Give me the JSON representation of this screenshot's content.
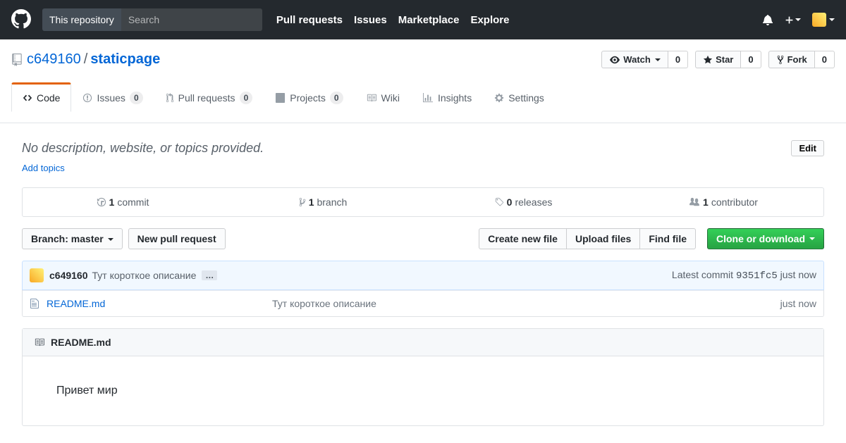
{
  "header": {
    "scope_label": "This repository",
    "search_placeholder": "Search",
    "nav": {
      "pulls": "Pull requests",
      "issues": "Issues",
      "marketplace": "Marketplace",
      "explore": "Explore"
    }
  },
  "repo": {
    "owner": "c649160",
    "separator": "/",
    "name": "staticpage"
  },
  "actions": {
    "watch": {
      "label": "Watch",
      "count": "0"
    },
    "star": {
      "label": "Star",
      "count": "0"
    },
    "fork": {
      "label": "Fork",
      "count": "0"
    }
  },
  "tabs": {
    "code": "Code",
    "issues": {
      "label": "Issues",
      "count": "0"
    },
    "pulls": {
      "label": "Pull requests",
      "count": "0"
    },
    "projects": {
      "label": "Projects",
      "count": "0"
    },
    "wiki": "Wiki",
    "insights": "Insights",
    "settings": "Settings"
  },
  "meta": {
    "description": "No description, website, or topics provided.",
    "edit": "Edit",
    "add_topics": "Add topics"
  },
  "summary": {
    "commits": {
      "num": "1",
      "label": "commit"
    },
    "branches": {
      "num": "1",
      "label": "branch"
    },
    "releases": {
      "num": "0",
      "label": "releases"
    },
    "contributors": {
      "num": "1",
      "label": "contributor"
    }
  },
  "file_nav": {
    "branch_prefix": "Branch:",
    "branch_name": "master",
    "new_pr": "New pull request",
    "create_file": "Create new file",
    "upload": "Upload files",
    "find": "Find file",
    "clone": "Clone or download"
  },
  "commit_tease": {
    "author": "c649160",
    "message": "Тут короткое описание",
    "latest_label": "Latest commit",
    "sha": "9351fc5",
    "age": "just now"
  },
  "files": [
    {
      "name": "README.md",
      "message": "Тут короткое описание",
      "age": "just now"
    }
  ],
  "readme": {
    "title": "README.md",
    "body": "Привет мир"
  }
}
